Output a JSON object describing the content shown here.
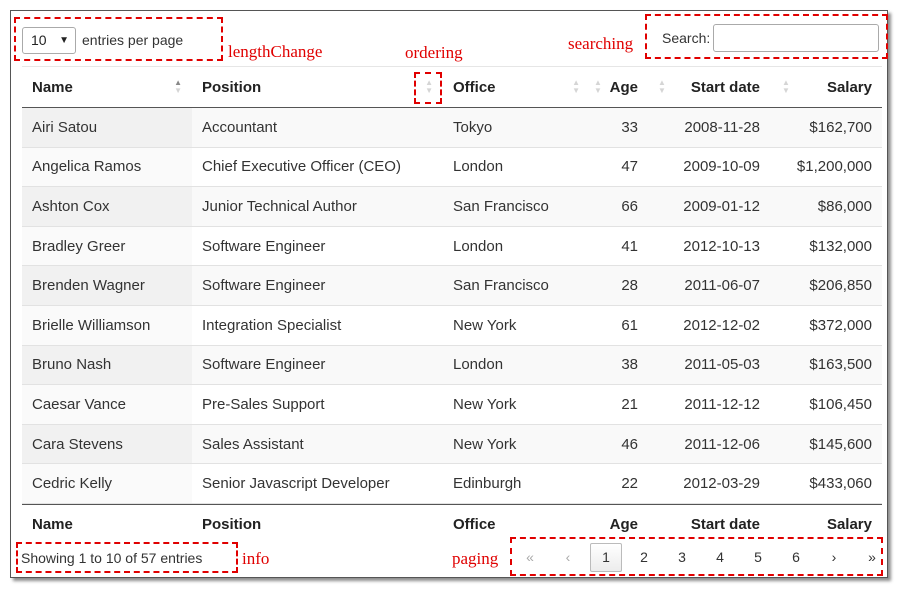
{
  "length": {
    "value": "10",
    "label": "entries per page"
  },
  "search": {
    "label": "Search:",
    "value": "",
    "placeholder": ""
  },
  "annotations": {
    "length_change": "lengthChange",
    "ordering": "ordering",
    "searching": "searching",
    "info": "info",
    "paging": "paging"
  },
  "columns": [
    {
      "label": "Name"
    },
    {
      "label": "Position"
    },
    {
      "label": "Office"
    },
    {
      "label": "Age"
    },
    {
      "label": "Start date"
    },
    {
      "label": "Salary"
    }
  ],
  "rows": [
    {
      "name": "Airi Satou",
      "position": "Accountant",
      "office": "Tokyo",
      "age": "33",
      "start": "2008-11-28",
      "salary": "$162,700"
    },
    {
      "name": "Angelica Ramos",
      "position": "Chief Executive Officer (CEO)",
      "office": "London",
      "age": "47",
      "start": "2009-10-09",
      "salary": "$1,200,000"
    },
    {
      "name": "Ashton Cox",
      "position": "Junior Technical Author",
      "office": "San Francisco",
      "age": "66",
      "start": "2009-01-12",
      "salary": "$86,000"
    },
    {
      "name": "Bradley Greer",
      "position": "Software Engineer",
      "office": "London",
      "age": "41",
      "start": "2012-10-13",
      "salary": "$132,000"
    },
    {
      "name": "Brenden Wagner",
      "position": "Software Engineer",
      "office": "San Francisco",
      "age": "28",
      "start": "2011-06-07",
      "salary": "$206,850"
    },
    {
      "name": "Brielle Williamson",
      "position": "Integration Specialist",
      "office": "New York",
      "age": "61",
      "start": "2012-12-02",
      "salary": "$372,000"
    },
    {
      "name": "Bruno Nash",
      "position": "Software Engineer",
      "office": "London",
      "age": "38",
      "start": "2011-05-03",
      "salary": "$163,500"
    },
    {
      "name": "Caesar Vance",
      "position": "Pre-Sales Support",
      "office": "New York",
      "age": "21",
      "start": "2011-12-12",
      "salary": "$106,450"
    },
    {
      "name": "Cara Stevens",
      "position": "Sales Assistant",
      "office": "New York",
      "age": "46",
      "start": "2011-12-06",
      "salary": "$145,600"
    },
    {
      "name": "Cedric Kelly",
      "position": "Senior Javascript Developer",
      "office": "Edinburgh",
      "age": "22",
      "start": "2012-03-29",
      "salary": "$433,060"
    }
  ],
  "info": "Showing 1 to 10 of 57 entries",
  "pagination": {
    "first": "«",
    "prev": "‹",
    "pages": [
      "1",
      "2",
      "3",
      "4",
      "5",
      "6"
    ],
    "current": "1",
    "next": "›",
    "last": "»"
  },
  "colors": {
    "annotation": "#e00000",
    "border": "#555555",
    "stripe": "#f9f9f9"
  }
}
